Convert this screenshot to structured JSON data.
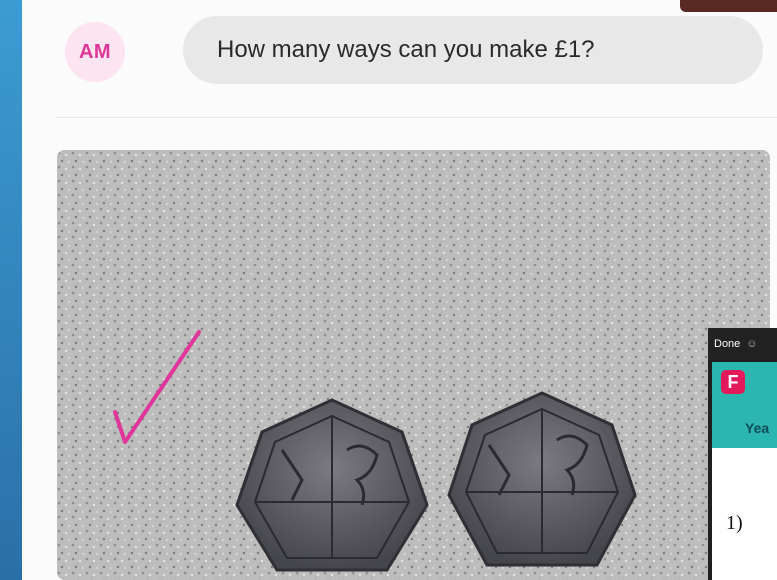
{
  "chat": {
    "avatar_initials": "AM",
    "message": "How many ways can you make £1?"
  },
  "photo": {
    "subject": "Two 50p coins on a speckled surface with a pink tick mark",
    "tick_color": "#e0369a",
    "coins": [
      {
        "label": "coin-left"
      },
      {
        "label": "coin-right"
      }
    ]
  },
  "inset": {
    "done_label": "Done",
    "badge_letter": "F",
    "year_label": "Yea",
    "question_number": "1)"
  },
  "colors": {
    "avatar_bg": "#fde4f0",
    "avatar_text": "#e0369a",
    "bubble_bg": "#e8e8e8",
    "inset_teal": "#2bb6b0",
    "badge_pink": "#e2195b"
  }
}
